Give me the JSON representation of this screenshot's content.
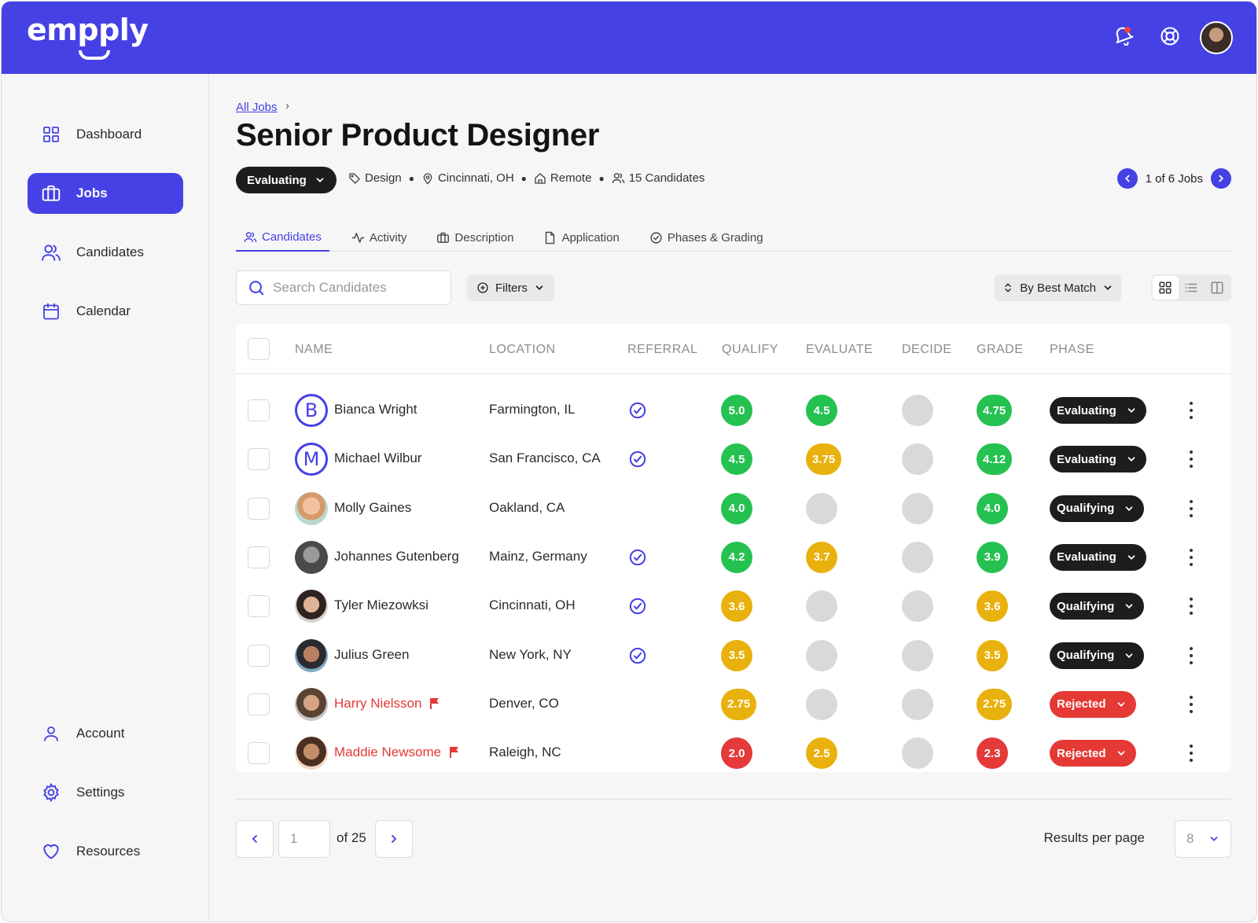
{
  "app": {
    "logo": "empply"
  },
  "colors": {
    "brand": "#4541e4",
    "green": "#25c151",
    "yellow": "#e9b10e",
    "red": "#e43a3a",
    "empty": "#d9d9db",
    "dark": "#1d1d1f"
  },
  "sidebar": {
    "items": [
      {
        "label": "Dashboard",
        "icon": "grid-icon"
      },
      {
        "label": "Jobs",
        "icon": "briefcase-icon",
        "active": true
      },
      {
        "label": "Candidates",
        "icon": "users-icon"
      },
      {
        "label": "Calendar",
        "icon": "calendar-icon"
      },
      {
        "label": "Account",
        "icon": "user-icon"
      },
      {
        "label": "Settings",
        "icon": "gear-icon"
      },
      {
        "label": "Resources",
        "icon": "heart-icon"
      }
    ]
  },
  "breadcrumb": {
    "link": "All Jobs",
    "separator": "›"
  },
  "job": {
    "title": "Senior Product Designer",
    "status": "Evaluating",
    "department": "Design",
    "location": "Cincinnati, OH",
    "work_type": "Remote",
    "candidates": "15 Candidates",
    "nav": "1 of 6 Jobs"
  },
  "tabs": [
    {
      "label": "Candidates",
      "active": true
    },
    {
      "label": "Activity"
    },
    {
      "label": "Description"
    },
    {
      "label": "Application"
    },
    {
      "label": "Phases & Grading"
    }
  ],
  "toolbar": {
    "search_placeholder": "Search Candidates",
    "filters": "Filters",
    "sort": "By Best Match"
  },
  "table": {
    "headers": [
      "NAME",
      "LOCATION",
      "REFERRAL",
      "QUALIFY",
      "EVALUATE",
      "DECIDE",
      "GRADE",
      "PHASE"
    ],
    "rows": [
      {
        "name": "Bianca Wright",
        "initial": "B",
        "location": "Farmington, IL",
        "referral": true,
        "qualify": "5.0",
        "evaluate": "4.5",
        "decide": "",
        "grade": "4.75",
        "phase": "Evaluating"
      },
      {
        "name": "Michael Wilbur",
        "initial": "M",
        "location": "San Francisco, CA",
        "referral": true,
        "qualify": "4.5",
        "evaluate": "3.75",
        "decide": "",
        "grade": "4.12",
        "phase": "Evaluating"
      },
      {
        "name": "Molly Gaines",
        "location": "Oakland, CA",
        "referral": false,
        "qualify": "4.0",
        "evaluate": "",
        "decide": "",
        "grade": "4.0",
        "phase": "Qualifying"
      },
      {
        "name": "Johannes Gutenberg",
        "location": "Mainz, Germany",
        "referral": true,
        "qualify": "4.2",
        "evaluate": "3.7",
        "decide": "",
        "grade": "3.9",
        "phase": "Evaluating"
      },
      {
        "name": "Tyler Miezowksi",
        "location": "Cincinnati, OH",
        "referral": true,
        "qualify": "3.6",
        "evaluate": "",
        "decide": "",
        "grade": "3.6",
        "phase": "Qualifying"
      },
      {
        "name": "Julius Green",
        "location": "New York, NY",
        "referral": true,
        "qualify": "3.5",
        "evaluate": "",
        "decide": "",
        "grade": "3.5",
        "phase": "Qualifying"
      },
      {
        "name": "Harry Nielsson",
        "location": "Denver, CO",
        "referral": false,
        "flagged": true,
        "qualify": "2.75",
        "evaluate": "",
        "decide": "",
        "grade": "2.75",
        "phase": "Rejected"
      },
      {
        "name": "Maddie Newsome",
        "location": "Raleigh, NC",
        "referral": false,
        "flagged": true,
        "qualify": "2.0",
        "evaluate": "2.5",
        "decide": "",
        "grade": "2.3",
        "phase": "Rejected"
      }
    ]
  },
  "pagination": {
    "page": "1",
    "of": "of 25",
    "rpp_label": "Results per page",
    "rpp_value": "8"
  }
}
